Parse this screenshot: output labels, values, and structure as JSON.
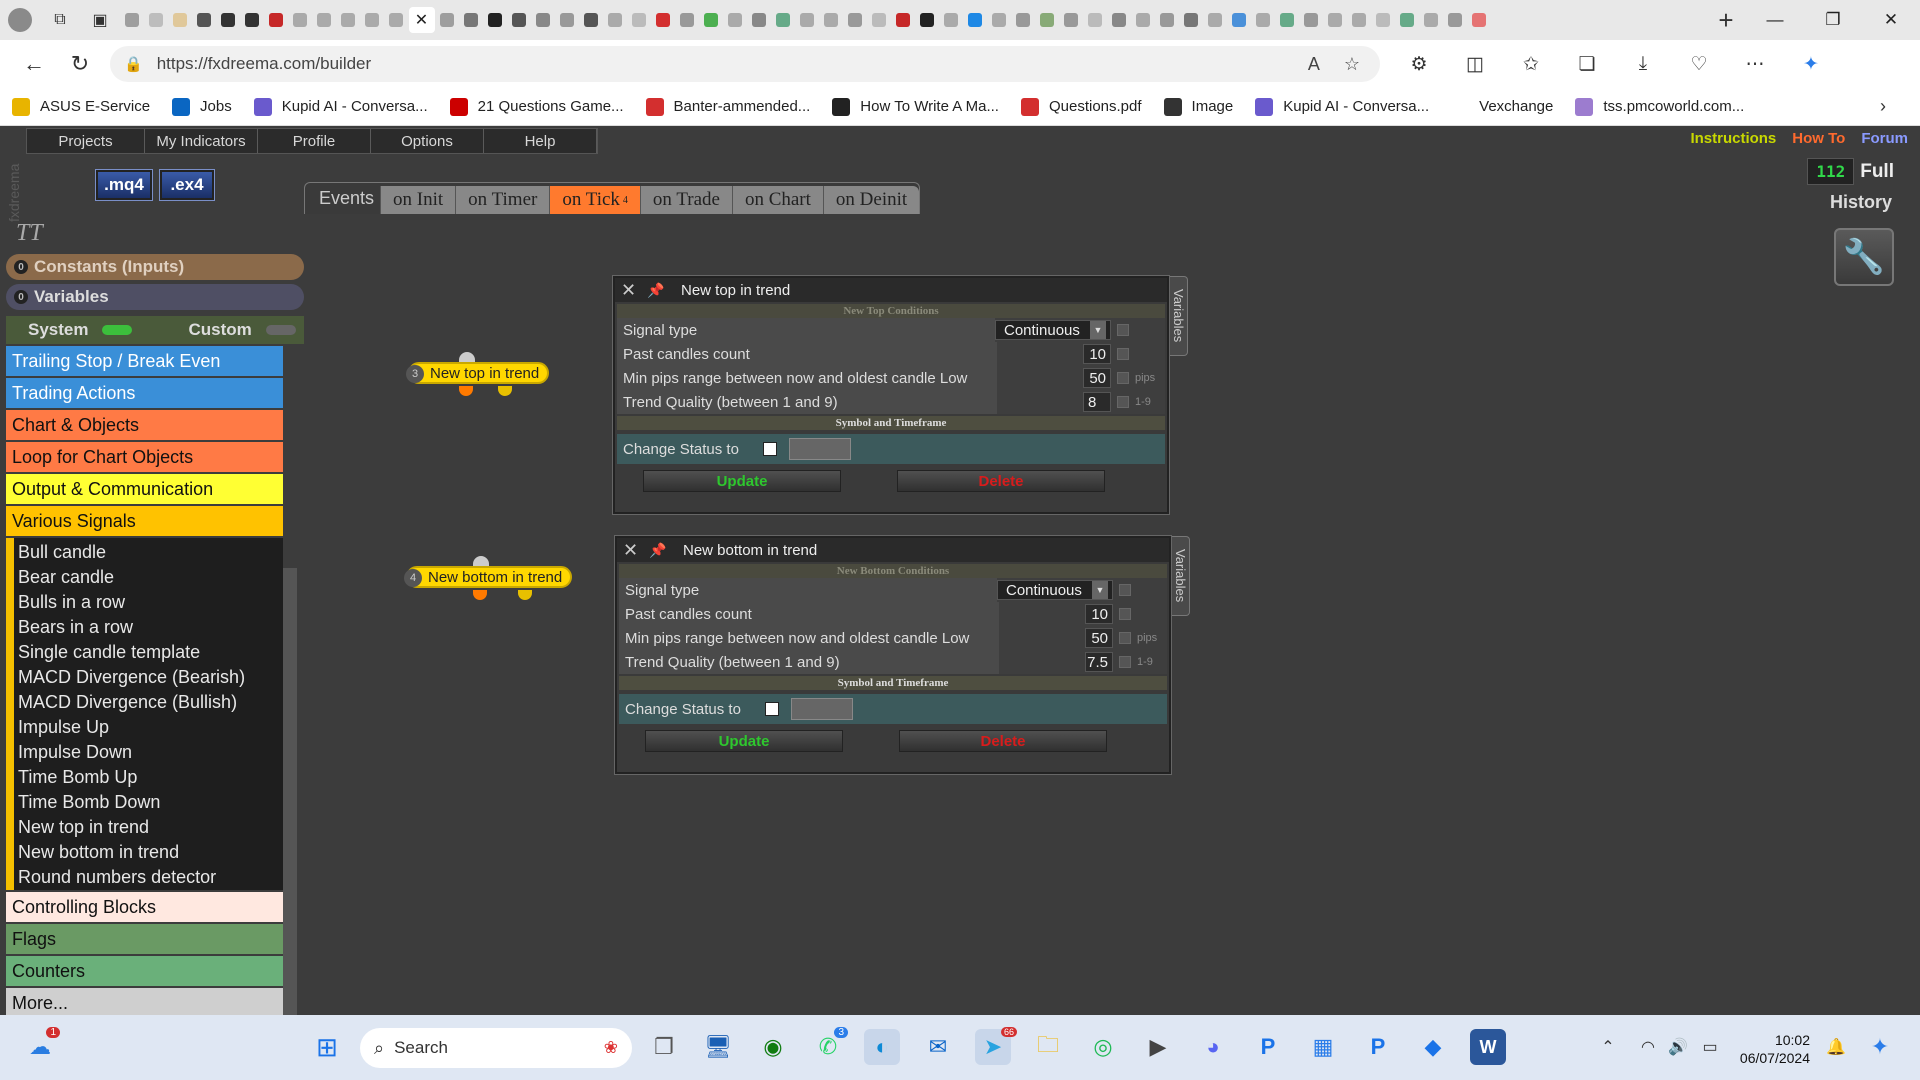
{
  "browser": {
    "url": "https://fxdreema.com/builder",
    "window_controls": [
      "—",
      "❐",
      "✕"
    ],
    "bookmarks": [
      {
        "label": "ASUS E-Service",
        "icon": "folder-icon",
        "color": "#e8b400"
      },
      {
        "label": "Jobs",
        "icon": "linkedin-icon",
        "color": "#0a66c2"
      },
      {
        "label": "Kupid AI - Conversa...",
        "icon": "kupid-icon",
        "color": "#6a5acd"
      },
      {
        "label": "21 Questions Game...",
        "icon": "tv-icon",
        "color": "#c00"
      },
      {
        "label": "Banter-ammended...",
        "icon": "pdf-icon",
        "color": "#d32f2f"
      },
      {
        "label": "How To Write A Ma...",
        "icon": "v-icon",
        "color": "#222"
      },
      {
        "label": "Questions.pdf",
        "icon": "pdf-icon",
        "color": "#d32f2f"
      },
      {
        "label": "Image",
        "icon": "image-icon",
        "color": "#333"
      },
      {
        "label": "Kupid AI - Conversa...",
        "icon": "kupid-icon",
        "color": "#6a5acd"
      },
      {
        "label": "Vexchange",
        "icon": "blank-icon",
        "color": "#ffffff"
      },
      {
        "label": "tss.pmcoworld.com...",
        "icon": "globe-icon",
        "color": "#9c7ccf"
      }
    ]
  },
  "app": {
    "brand": "fxdreema",
    "menu": [
      "Projects",
      "My Indicators",
      "Profile",
      "Options",
      "Help"
    ],
    "links": [
      {
        "label": "Instructions",
        "color": "#c8d800"
      },
      {
        "label": "How To",
        "color": "#ff6a2e"
      },
      {
        "label": "Forum",
        "color": "#8a9aff"
      }
    ],
    "history_count": "112",
    "full_label": "Full",
    "history_label": "History",
    "mq4": ".mq4",
    "ex4": ".ex4",
    "events_label": "Events",
    "events": [
      "on Init",
      "on Timer",
      "on Tick",
      "on Trade",
      "on Chart",
      "on Deinit"
    ],
    "active_event_badge": "4",
    "tt": "TT",
    "constants": "Constants (Inputs)",
    "variables": "Variables",
    "system": "System",
    "custom": "Custom",
    "categories_top": [
      {
        "label": "Trailing Stop / Break Even",
        "bg": "#3a8fd8",
        "fg": "#ffffff"
      },
      {
        "label": "Trading Actions",
        "bg": "#3a8fd8",
        "fg": "#ffffff"
      },
      {
        "label": "Chart & Objects",
        "bg": "#ff7a45",
        "fg": "#111111"
      },
      {
        "label": "Loop for Chart Objects",
        "bg": "#ff7a45",
        "fg": "#111111"
      },
      {
        "label": "Output & Communication",
        "bg": "#ffff33",
        "fg": "#111111"
      },
      {
        "label": "Various Signals",
        "bg": "#ffc200",
        "fg": "#111111"
      }
    ],
    "signals": [
      "Bull candle",
      "Bear candle",
      "Bulls in a row",
      "Bears in a row",
      "Single candle template",
      "MACD Divergence (Bearish)",
      "MACD Divergence (Bullish)",
      "Impulse Up",
      "Impulse Down",
      "Time Bomb Up",
      "Time Bomb Down",
      "New top in trend",
      "New bottom in trend",
      "Round numbers detector"
    ],
    "categories_bottom": [
      {
        "label": "Controlling Blocks",
        "bg": "#ffe8e0",
        "fg": "#111111"
      },
      {
        "label": "Flags",
        "bg": "#6a9a64",
        "fg": "#111111"
      },
      {
        "label": "Counters",
        "bg": "#6ab07a",
        "fg": "#111111"
      },
      {
        "label": "More...",
        "bg": "#cfcfcf",
        "fg": "#111111"
      }
    ]
  },
  "blocks": [
    {
      "num": "3",
      "label": "New top in trend"
    },
    {
      "num": "4",
      "label": "New bottom in trend"
    }
  ],
  "dialogs": [
    {
      "title": "New top in trend",
      "section": "New Top Conditions",
      "rows": [
        {
          "label": "Signal type",
          "value": "Continuous",
          "unit": ""
        },
        {
          "label": "Past candles count",
          "value": "10",
          "unit": ""
        },
        {
          "label": "Min pips range between now and oldest candle Low",
          "value": "50",
          "unit": "pips"
        },
        {
          "label": "Trend Quality (between 1 and 9)",
          "value": "8",
          "unit": "1-9"
        }
      ],
      "section2": "Symbol and Timeframe",
      "status_label": "Change Status to",
      "update": "Update",
      "delete": "Delete",
      "side_tab": "Variables"
    },
    {
      "title": "New bottom in trend",
      "section": "New Bottom Conditions",
      "rows": [
        {
          "label": "Signal type",
          "value": "Continuous",
          "unit": ""
        },
        {
          "label": "Past candles count",
          "value": "10",
          "unit": ""
        },
        {
          "label": "Min pips range between now and oldest candle Low",
          "value": "50",
          "unit": "pips"
        },
        {
          "label": "Trend Quality (between 1 and 9)",
          "value": "7.5",
          "unit": "1-9"
        }
      ],
      "section2": "Symbol and Timeframe",
      "status_label": "Change Status to",
      "update": "Update",
      "delete": "Delete",
      "side_tab": "Variables"
    }
  ],
  "taskbar": {
    "search_placeholder": "Search",
    "notification_badge": "1",
    "whatsapp_badge": "3",
    "telegram_badge": "66",
    "time": "10:02",
    "date": "06/07/2024"
  }
}
